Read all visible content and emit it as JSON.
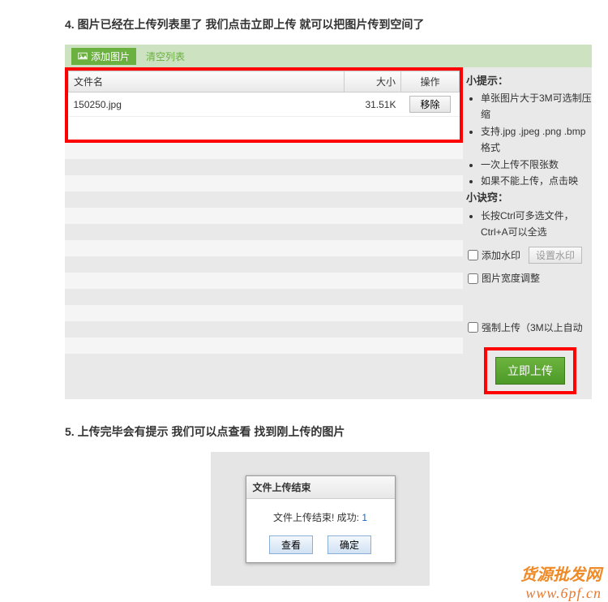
{
  "step4": {
    "title": "4. 图片已经在上传列表里了  我们点击立即上传  就可以把图片传到空间了",
    "toolbar": {
      "add": "添加图片",
      "clear": "清空列表"
    },
    "table": {
      "headers": {
        "name": "文件名",
        "size": "大小",
        "op": "操作"
      },
      "row": {
        "name": "150250.jpg",
        "size": "31.51K",
        "remove": "移除"
      }
    },
    "tips": {
      "heading": "小提示：",
      "items": [
        "单张图片大于3M可选制压缩",
        "支持.jpg .jpeg .png .bmp格式",
        "一次上传不限张数",
        "如果不能上传，点击映"
      ]
    },
    "tricks": {
      "heading": "小诀窍：",
      "items": [
        "长按Ctrl可多选文件，Ctrl+A可以全选"
      ]
    },
    "options": {
      "watermark_label": "添加水印",
      "watermark_btn": "设置水印",
      "width_label": "图片宽度调整",
      "force_label": "强制上传（3M以上自动"
    },
    "upload_btn": "立即上传"
  },
  "step5": {
    "title": "5. 上传完毕会有提示  我们可以点查看  找到刚上传的图片",
    "dialog": {
      "title": "文件上传结束",
      "body_prefix": "文件上传结束! 成功: ",
      "count": "1",
      "view": "查看",
      "ok": "确定"
    }
  },
  "watermark": {
    "line1": "货源批发网",
    "line2": "www.6pf.cn"
  }
}
